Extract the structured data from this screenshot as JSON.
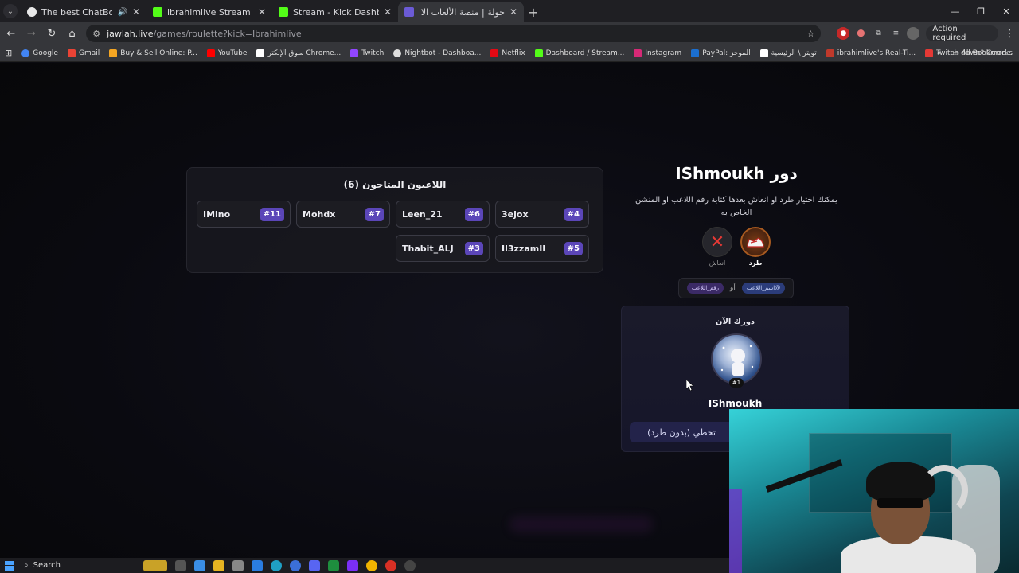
{
  "browser": {
    "tabs": [
      {
        "title": "The best ChatBot and Widg",
        "favicon_color": "#e8e8e8",
        "has_audio": true,
        "active": false
      },
      {
        "title": "ibrahimlive Stream - Watch Live",
        "favicon_color": "#53fc18",
        "has_audio": false,
        "active": false
      },
      {
        "title": "Stream - Kick Dashboard",
        "favicon_color": "#53fc18",
        "has_audio": false,
        "active": false
      },
      {
        "title": "جولة | منصة الألعاب الا - Jawlah",
        "favicon_color": "#6b5bd6",
        "has_audio": false,
        "active": true
      }
    ],
    "new_tab": "+",
    "url_host": "jawlah.live",
    "url_path": "/games/roulette?kick=Ibrahimlive",
    "action_required": "Action required",
    "bookmarks": [
      {
        "label": "Google",
        "color": "#4285f4"
      },
      {
        "label": "Gmail",
        "color": "#ea4335"
      },
      {
        "label": "Buy & Sell Online: P...",
        "color": "#f5a623"
      },
      {
        "label": "YouTube",
        "color": "#ff0000"
      },
      {
        "label": "سوق الإلكتر Chrome...",
        "color": "#ffffff"
      },
      {
        "label": "Twitch",
        "color": "#9146ff"
      },
      {
        "label": "Nightbot - Dashboa...",
        "color": "#dddddd"
      },
      {
        "label": "Netflix",
        "color": "#e50914"
      },
      {
        "label": "Dashboard / Stream...",
        "color": "#53fc18"
      },
      {
        "label": "Instagram",
        "color": "#d62976"
      },
      {
        "label": "PayPal: الموجز",
        "color": "#1b6fd1"
      },
      {
        "label": "تويتر \\ الرئيسية",
        "color": "#ffffff"
      },
      {
        "label": "ibrahimlive's Real-Ti...",
        "color": "#c0392b"
      },
      {
        "label": "Twitch down? Curre...",
        "color": "#e53935"
      }
    ],
    "all_bookmarks": "All Bookmarks"
  },
  "game": {
    "players_title": "اللاعبون المتاحون (6)",
    "players": [
      {
        "name": "IMino",
        "num": "#11"
      },
      {
        "name": "Mohdx",
        "num": "#7"
      },
      {
        "name": "Leen_21",
        "num": "#6"
      },
      {
        "name": "3ejox",
        "num": "#4"
      },
      {
        "name": "Thabit_ALJ",
        "num": "#3"
      },
      {
        "name": "Il3zzamII",
        "num": "#5"
      }
    ],
    "turn_title": "دور IShmoukh",
    "turn_desc": "يمكنك اختيار طرد او انعاش بعدها كتابة رقم اللاعب او المنشن الخاص به",
    "kick_label": "طرد",
    "revive_label": "انعاش",
    "hint_name": "@اسم_اللاعب",
    "hint_or": "أو",
    "hint_number": "رقم_اللاعب",
    "current_label": "دورك الآن",
    "current_num": "#1",
    "current_name": "IShmoukh",
    "skip_label": "تخطي (بدون طرد)"
  },
  "taskbar": {
    "search": "Search"
  }
}
